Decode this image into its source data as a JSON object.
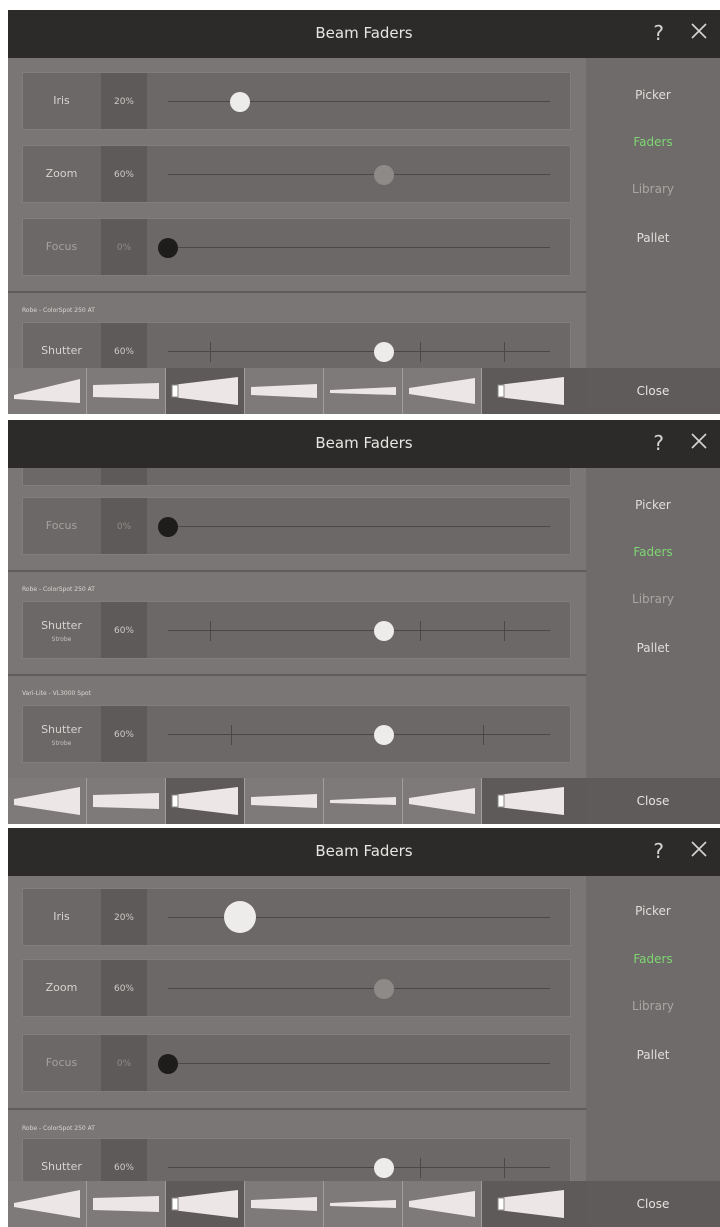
{
  "app": {
    "title": "Beam Faders",
    "help": "?",
    "close_label": "Close"
  },
  "sidebar": {
    "items": [
      {
        "label": "Picker",
        "state": "normal"
      },
      {
        "label": "Faders",
        "state": "active"
      },
      {
        "label": "Library",
        "state": "dim"
      },
      {
        "label": "Pallet",
        "state": "normal"
      }
    ]
  },
  "colors": {
    "active_accent": "#7fd672",
    "titlebar": "#2d2b2a",
    "panel": "#7a7675"
  },
  "fixtures": {
    "robe": "Robe - ColorSpot 250 AT",
    "varilite": "Vari-Lite - VL3000 Spot"
  },
  "faders": {
    "iris": {
      "label": "Iris",
      "value": "20%",
      "level": 0.2
    },
    "zoom": {
      "label": "Zoom",
      "value": "60%",
      "level": 0.6
    },
    "focus": {
      "label": "Focus",
      "value": "0%",
      "level": 0.0
    },
    "robe_shutter": {
      "label": "Shutter",
      "sub": "Strobe",
      "value": "60%",
      "level": 0.6
    },
    "vl_shutter": {
      "label": "Shutter",
      "sub": "Strobe",
      "value": "60%",
      "level": 0.6
    }
  },
  "beam_presets": [
    {
      "icon": "wide-beam-icon",
      "selected": false
    },
    {
      "icon": "parallel-beam-icon",
      "selected": false
    },
    {
      "icon": "wide-beam-icon",
      "selected": true
    },
    {
      "icon": "narrow-beam-icon",
      "selected": false
    },
    {
      "icon": "very-narrow-beam-icon",
      "selected": false
    },
    {
      "icon": "wide-beam-icon",
      "selected": false
    },
    {
      "icon": "wide-beam-icon",
      "selected": true
    }
  ]
}
